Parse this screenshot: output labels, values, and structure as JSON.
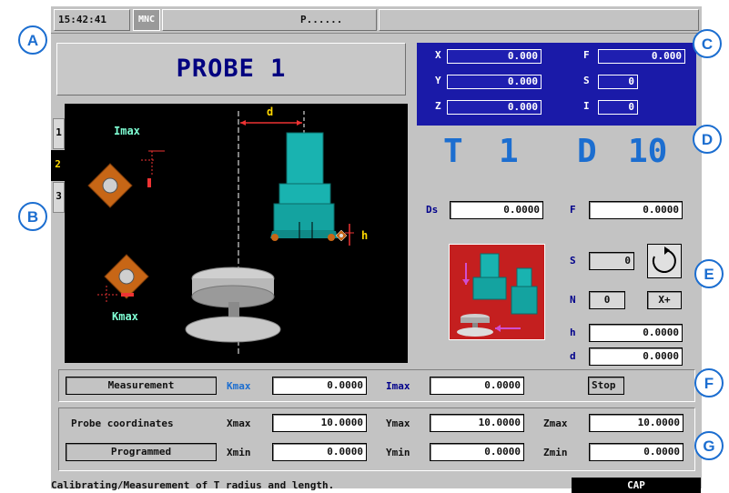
{
  "status_bar": {
    "time": "15:42:41",
    "mode": "MNC",
    "program": "P......"
  },
  "title": "PROBE 1",
  "tabs": [
    "1",
    "2",
    "3"
  ],
  "callouts": [
    "A",
    "B",
    "C",
    "D",
    "E",
    "F",
    "G"
  ],
  "graphic": {
    "dim_d": "d",
    "dim_h": "h",
    "imax": "Imax",
    "kmax": "Kmax"
  },
  "coords": {
    "x": {
      "label": "X",
      "value": "0.000"
    },
    "y": {
      "label": "Y",
      "value": "0.000"
    },
    "z": {
      "label": "Z",
      "value": "0.000"
    },
    "f": {
      "label": "F",
      "value": "0.000"
    },
    "s": {
      "label": "S",
      "value": "0"
    },
    "i": {
      "label": "I",
      "value": "0"
    }
  },
  "tool": {
    "t_label": "T",
    "t_value": "1",
    "d_label": "D",
    "d_value": "10"
  },
  "params": {
    "ds_label": "Ds",
    "ds_value": "0.0000",
    "f_label": "F",
    "f_value": "0.0000",
    "s_label": "S",
    "s_value": "0",
    "n_label": "N",
    "n_value": "0",
    "axis_value": "X+",
    "h_label": "h",
    "h_value": "0.0000",
    "d_label": "d",
    "d_value": "0.0000"
  },
  "measure": {
    "mode": "Measurement",
    "kmax_label": "Kmax",
    "kmax_value": "0.0000",
    "imax_label": "Imax",
    "imax_value": "0.0000",
    "stop": "Stop"
  },
  "probe": {
    "coords_label": "Probe coordinates",
    "programmed": "Programmed",
    "xmax_label": "Xmax",
    "xmax_value": "10.0000",
    "ymax_label": "Ymax",
    "ymax_value": "10.0000",
    "zmax_label": "Zmax",
    "zmax_value": "10.0000",
    "xmin_label": "Xmin",
    "xmin_value": "0.0000",
    "ymin_label": "Ymin",
    "ymin_value": "0.0000",
    "zmin_label": "Zmin",
    "zmin_value": "0.0000"
  },
  "footer": {
    "message": "Calibrating/Measurement of T radius and length.",
    "cap": "CAP"
  }
}
